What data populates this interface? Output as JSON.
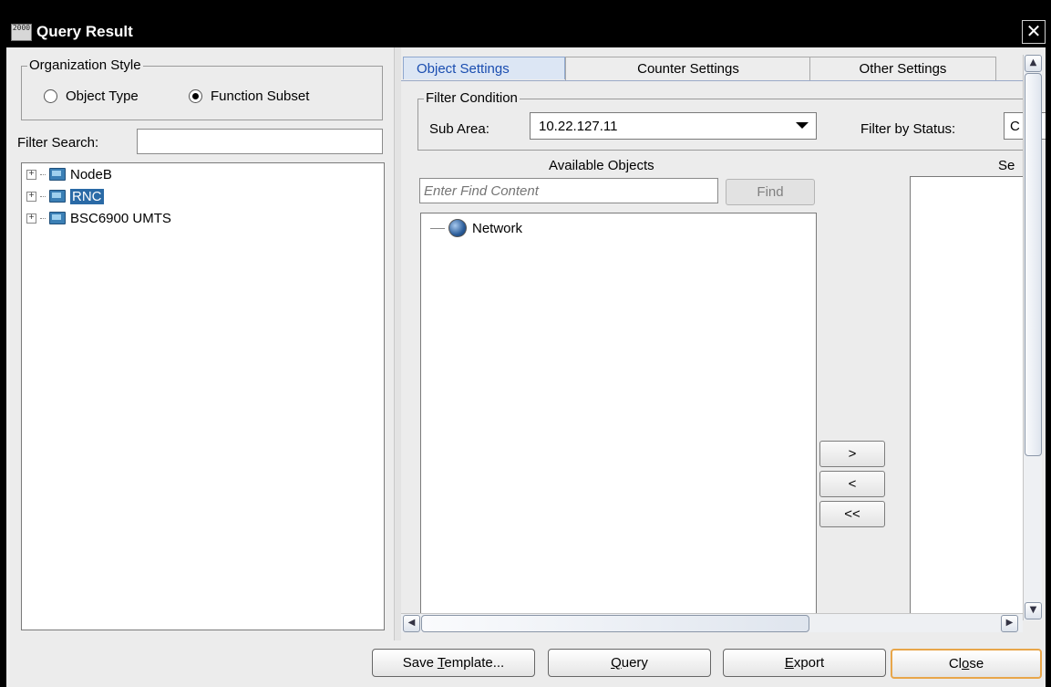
{
  "window": {
    "title": "Query Result",
    "app_icon_text": "2000",
    "close_glyph": "✕"
  },
  "left": {
    "org_style": {
      "legend": "Organization Style",
      "options": [
        {
          "label": "Object Type",
          "selected": false
        },
        {
          "label": "Function Subset",
          "selected": true
        }
      ]
    },
    "filter_search_label": "Filter Search:",
    "filter_search_value": "",
    "tree": [
      {
        "label": "NodeB",
        "expander": "+",
        "selected": false
      },
      {
        "label": "RNC",
        "expander": "+",
        "selected": true
      },
      {
        "label": "BSC6900 UMTS",
        "expander": "+",
        "selected": false
      }
    ]
  },
  "right": {
    "tabs": [
      {
        "label": "Object Settings",
        "active": true
      },
      {
        "label": "Counter Settings",
        "active": false
      },
      {
        "label": "Other Settings",
        "active": false
      }
    ],
    "filter_condition": {
      "legend": "Filter Condition",
      "sub_area_label": "Sub Area:",
      "sub_area_value": "10.22.127.11",
      "filter_by_status_label": "Filter by Status:",
      "filter_by_status_value": "C"
    },
    "available_objects": {
      "header": "Available Objects",
      "find_placeholder": "Enter Find Content",
      "find_button": "Find",
      "items": [
        {
          "label": "Network",
          "icon": "globe-icon"
        }
      ]
    },
    "selected_objects_header": "Se",
    "move_buttons": {
      "add": ">",
      "remove": "<",
      "remove_all": "<<"
    },
    "scroll": {
      "up": "▲",
      "down": "▼",
      "left": "◀",
      "right": "▶"
    }
  },
  "footer": {
    "save_template": {
      "pre": "Save ",
      "key": "T",
      "post": "emplate..."
    },
    "query": {
      "pre": "",
      "key": "Q",
      "post": "uery"
    },
    "export": {
      "pre": "",
      "key": "E",
      "post": "xport"
    },
    "close": {
      "pre": "Cl",
      "key": "o",
      "post": "se"
    }
  },
  "colors": {
    "selection": "#2a6aa6",
    "active_tab_text": "#1a4db0",
    "focus_border": "#e8a64a"
  }
}
